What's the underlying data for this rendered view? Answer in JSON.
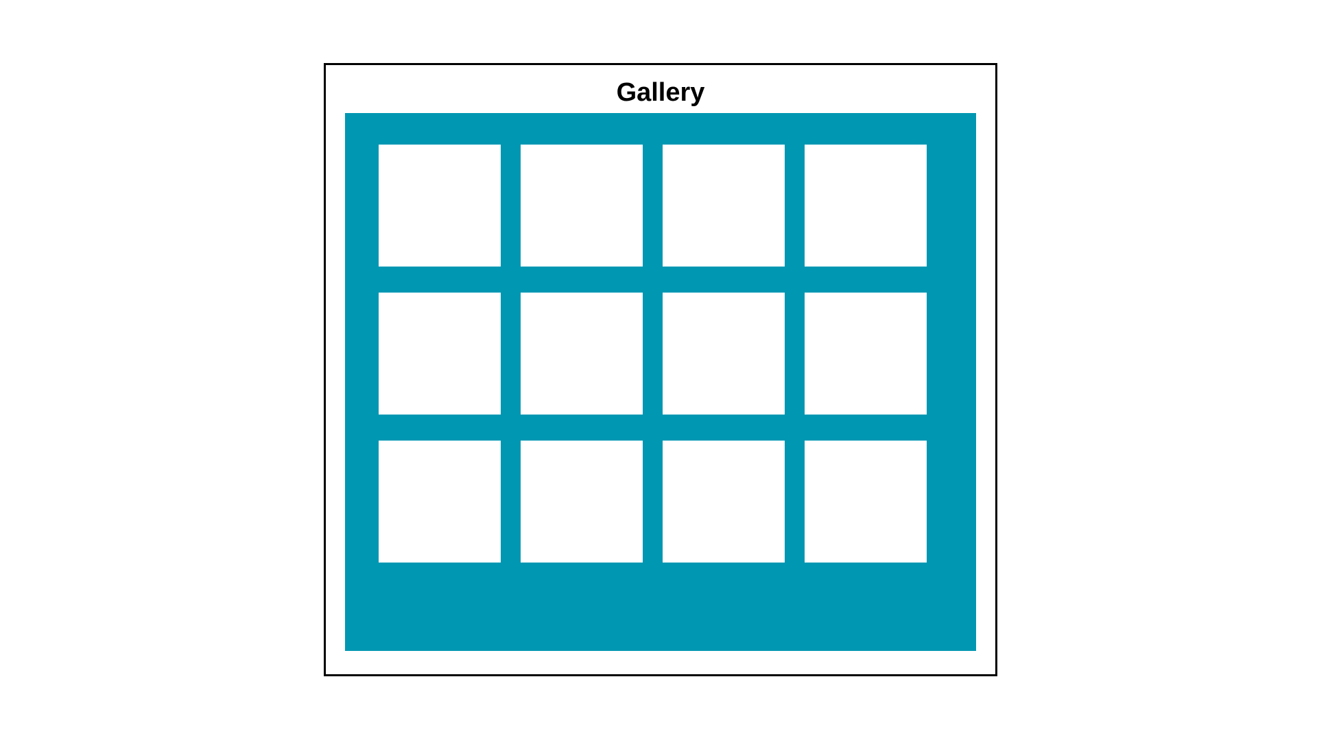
{
  "gallery": {
    "title": "Gallery",
    "panel_color": "#0097b2",
    "tiles": [
      {
        "row": 1,
        "col": 1
      },
      {
        "row": 1,
        "col": 2
      },
      {
        "row": 1,
        "col": 3
      },
      {
        "row": 1,
        "col": 4
      },
      {
        "row": 2,
        "col": 1
      },
      {
        "row": 2,
        "col": 2
      },
      {
        "row": 2,
        "col": 3
      },
      {
        "row": 2,
        "col": 4
      },
      {
        "row": 3,
        "col": 1
      },
      {
        "row": 3,
        "col": 2
      },
      {
        "row": 3,
        "col": 3
      },
      {
        "row": 3,
        "col": 4
      }
    ]
  }
}
